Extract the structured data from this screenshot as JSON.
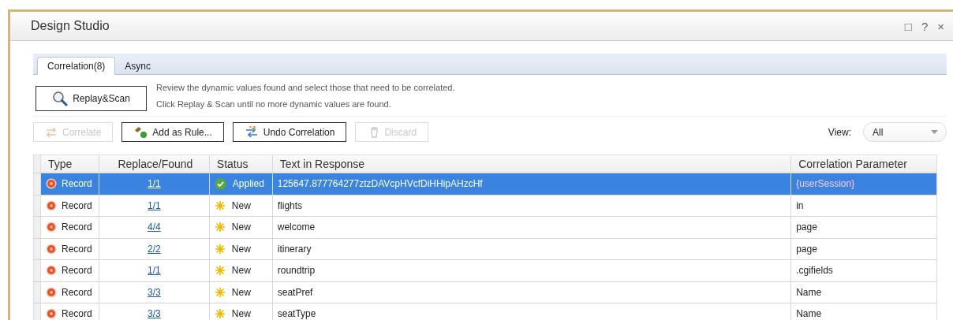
{
  "window": {
    "title": "Design Studio",
    "controls": [
      "□",
      "?",
      "×"
    ]
  },
  "tabs": [
    {
      "label": "Correlation(8)",
      "selected": true
    },
    {
      "label": "Async",
      "selected": false
    }
  ],
  "scan": {
    "button": "Replay&Scan",
    "hints": [
      "Review the dynamic values found and select those that need to be correlated.",
      "Click Replay & Scan until no more dynamic values are found."
    ]
  },
  "toolbar": [
    {
      "label": "Correlate",
      "kind": "correlate",
      "disabled": true
    },
    {
      "label": "Add as Rule...",
      "kind": "rule",
      "disabled": false
    },
    {
      "label": "Undo Correlation",
      "kind": "undo",
      "disabled": false
    },
    {
      "label": "Discard",
      "kind": "discard",
      "disabled": true
    }
  ],
  "view": {
    "label": "View:",
    "value": "All"
  },
  "table": {
    "columns": [
      "Type",
      "Replace/Found",
      "Status",
      "Text in Response",
      "Correlation Parameter"
    ],
    "rows": [
      {
        "type": "Record",
        "found": "1/1",
        "status": "Applied",
        "kind": "applied",
        "text": "125647.877764277ztzDAVcpHVcfDiHHipAHzcHf",
        "parameter": "{userSession}",
        "selected": true
      },
      {
        "type": "Record",
        "found": "1/1",
        "status": "New",
        "kind": "new",
        "text": "flights",
        "parameter": "in",
        "selected": false
      },
      {
        "type": "Record",
        "found": "4/4",
        "status": "New",
        "kind": "new",
        "text": "welcome",
        "parameter": "page",
        "selected": false
      },
      {
        "type": "Record",
        "found": "2/2",
        "status": "New",
        "kind": "new",
        "text": "itinerary",
        "parameter": "page",
        "selected": false
      },
      {
        "type": "Record",
        "found": "1/1",
        "status": "New",
        "kind": "new",
        "text": "roundtrip",
        "parameter": ".cgifields",
        "selected": false
      },
      {
        "type": "Record",
        "found": "3/3",
        "status": "New",
        "kind": "new",
        "text": "seatPref",
        "parameter": "Name",
        "selected": false
      },
      {
        "type": "Record",
        "found": "3/3",
        "status": "New",
        "kind": "new",
        "text": "seatType",
        "parameter": "Name",
        "selected": false
      }
    ]
  }
}
